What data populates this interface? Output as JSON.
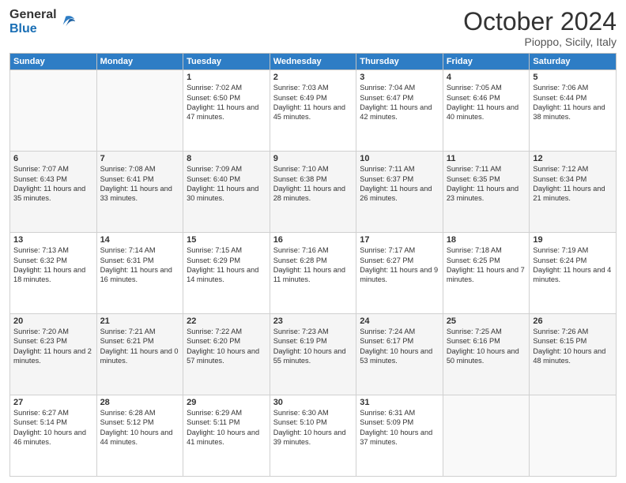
{
  "logo": {
    "general": "General",
    "blue": "Blue"
  },
  "header": {
    "month": "October 2024",
    "location": "Pioppo, Sicily, Italy"
  },
  "weekdays": [
    "Sunday",
    "Monday",
    "Tuesday",
    "Wednesday",
    "Thursday",
    "Friday",
    "Saturday"
  ],
  "weeks": [
    [
      {
        "day": "",
        "sunrise": "",
        "sunset": "",
        "daylight": ""
      },
      {
        "day": "",
        "sunrise": "",
        "sunset": "",
        "daylight": ""
      },
      {
        "day": "1",
        "sunrise": "Sunrise: 7:02 AM",
        "sunset": "Sunset: 6:50 PM",
        "daylight": "Daylight: 11 hours and 47 minutes."
      },
      {
        "day": "2",
        "sunrise": "Sunrise: 7:03 AM",
        "sunset": "Sunset: 6:49 PM",
        "daylight": "Daylight: 11 hours and 45 minutes."
      },
      {
        "day": "3",
        "sunrise": "Sunrise: 7:04 AM",
        "sunset": "Sunset: 6:47 PM",
        "daylight": "Daylight: 11 hours and 42 minutes."
      },
      {
        "day": "4",
        "sunrise": "Sunrise: 7:05 AM",
        "sunset": "Sunset: 6:46 PM",
        "daylight": "Daylight: 11 hours and 40 minutes."
      },
      {
        "day": "5",
        "sunrise": "Sunrise: 7:06 AM",
        "sunset": "Sunset: 6:44 PM",
        "daylight": "Daylight: 11 hours and 38 minutes."
      }
    ],
    [
      {
        "day": "6",
        "sunrise": "Sunrise: 7:07 AM",
        "sunset": "Sunset: 6:43 PM",
        "daylight": "Daylight: 11 hours and 35 minutes."
      },
      {
        "day": "7",
        "sunrise": "Sunrise: 7:08 AM",
        "sunset": "Sunset: 6:41 PM",
        "daylight": "Daylight: 11 hours and 33 minutes."
      },
      {
        "day": "8",
        "sunrise": "Sunrise: 7:09 AM",
        "sunset": "Sunset: 6:40 PM",
        "daylight": "Daylight: 11 hours and 30 minutes."
      },
      {
        "day": "9",
        "sunrise": "Sunrise: 7:10 AM",
        "sunset": "Sunset: 6:38 PM",
        "daylight": "Daylight: 11 hours and 28 minutes."
      },
      {
        "day": "10",
        "sunrise": "Sunrise: 7:11 AM",
        "sunset": "Sunset: 6:37 PM",
        "daylight": "Daylight: 11 hours and 26 minutes."
      },
      {
        "day": "11",
        "sunrise": "Sunrise: 7:11 AM",
        "sunset": "Sunset: 6:35 PM",
        "daylight": "Daylight: 11 hours and 23 minutes."
      },
      {
        "day": "12",
        "sunrise": "Sunrise: 7:12 AM",
        "sunset": "Sunset: 6:34 PM",
        "daylight": "Daylight: 11 hours and 21 minutes."
      }
    ],
    [
      {
        "day": "13",
        "sunrise": "Sunrise: 7:13 AM",
        "sunset": "Sunset: 6:32 PM",
        "daylight": "Daylight: 11 hours and 18 minutes."
      },
      {
        "day": "14",
        "sunrise": "Sunrise: 7:14 AM",
        "sunset": "Sunset: 6:31 PM",
        "daylight": "Daylight: 11 hours and 16 minutes."
      },
      {
        "day": "15",
        "sunrise": "Sunrise: 7:15 AM",
        "sunset": "Sunset: 6:29 PM",
        "daylight": "Daylight: 11 hours and 14 minutes."
      },
      {
        "day": "16",
        "sunrise": "Sunrise: 7:16 AM",
        "sunset": "Sunset: 6:28 PM",
        "daylight": "Daylight: 11 hours and 11 minutes."
      },
      {
        "day": "17",
        "sunrise": "Sunrise: 7:17 AM",
        "sunset": "Sunset: 6:27 PM",
        "daylight": "Daylight: 11 hours and 9 minutes."
      },
      {
        "day": "18",
        "sunrise": "Sunrise: 7:18 AM",
        "sunset": "Sunset: 6:25 PM",
        "daylight": "Daylight: 11 hours and 7 minutes."
      },
      {
        "day": "19",
        "sunrise": "Sunrise: 7:19 AM",
        "sunset": "Sunset: 6:24 PM",
        "daylight": "Daylight: 11 hours and 4 minutes."
      }
    ],
    [
      {
        "day": "20",
        "sunrise": "Sunrise: 7:20 AM",
        "sunset": "Sunset: 6:23 PM",
        "daylight": "Daylight: 11 hours and 2 minutes."
      },
      {
        "day": "21",
        "sunrise": "Sunrise: 7:21 AM",
        "sunset": "Sunset: 6:21 PM",
        "daylight": "Daylight: 11 hours and 0 minutes."
      },
      {
        "day": "22",
        "sunrise": "Sunrise: 7:22 AM",
        "sunset": "Sunset: 6:20 PM",
        "daylight": "Daylight: 10 hours and 57 minutes."
      },
      {
        "day": "23",
        "sunrise": "Sunrise: 7:23 AM",
        "sunset": "Sunset: 6:19 PM",
        "daylight": "Daylight: 10 hours and 55 minutes."
      },
      {
        "day": "24",
        "sunrise": "Sunrise: 7:24 AM",
        "sunset": "Sunset: 6:17 PM",
        "daylight": "Daylight: 10 hours and 53 minutes."
      },
      {
        "day": "25",
        "sunrise": "Sunrise: 7:25 AM",
        "sunset": "Sunset: 6:16 PM",
        "daylight": "Daylight: 10 hours and 50 minutes."
      },
      {
        "day": "26",
        "sunrise": "Sunrise: 7:26 AM",
        "sunset": "Sunset: 6:15 PM",
        "daylight": "Daylight: 10 hours and 48 minutes."
      }
    ],
    [
      {
        "day": "27",
        "sunrise": "Sunrise: 6:27 AM",
        "sunset": "Sunset: 5:14 PM",
        "daylight": "Daylight: 10 hours and 46 minutes."
      },
      {
        "day": "28",
        "sunrise": "Sunrise: 6:28 AM",
        "sunset": "Sunset: 5:12 PM",
        "daylight": "Daylight: 10 hours and 44 minutes."
      },
      {
        "day": "29",
        "sunrise": "Sunrise: 6:29 AM",
        "sunset": "Sunset: 5:11 PM",
        "daylight": "Daylight: 10 hours and 41 minutes."
      },
      {
        "day": "30",
        "sunrise": "Sunrise: 6:30 AM",
        "sunset": "Sunset: 5:10 PM",
        "daylight": "Daylight: 10 hours and 39 minutes."
      },
      {
        "day": "31",
        "sunrise": "Sunrise: 6:31 AM",
        "sunset": "Sunset: 5:09 PM",
        "daylight": "Daylight: 10 hours and 37 minutes."
      },
      {
        "day": "",
        "sunrise": "",
        "sunset": "",
        "daylight": ""
      },
      {
        "day": "",
        "sunrise": "",
        "sunset": "",
        "daylight": ""
      }
    ]
  ]
}
